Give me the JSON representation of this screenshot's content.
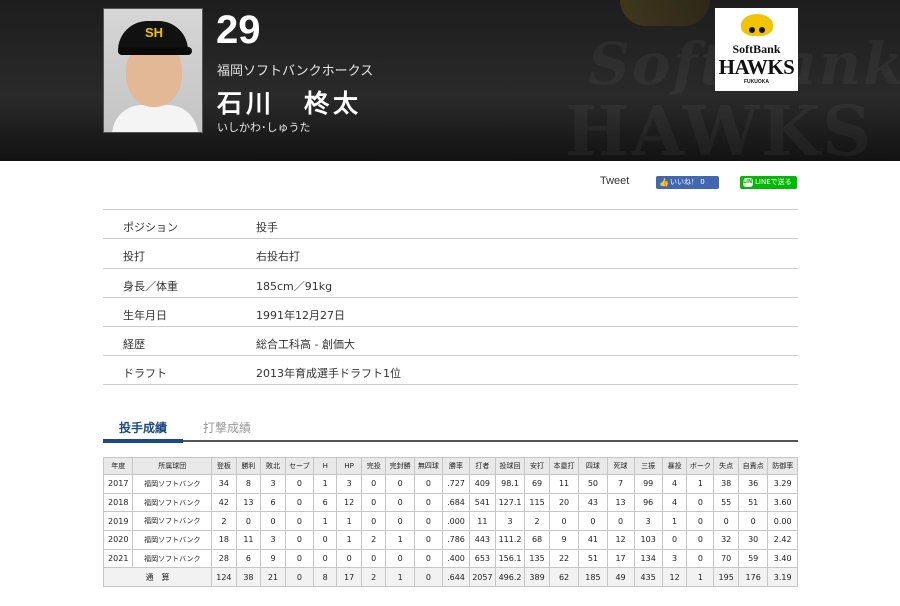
{
  "header": {
    "number": "29",
    "team": "福岡ソフトバンクホークス",
    "name": "石川　柊太",
    "kana": "いしかわ･しゅうた",
    "watermark_line1": "SoftBank",
    "watermark_line2": "HAWKS",
    "logo_line1": "SoftBank",
    "logo_line2": "HAWKS",
    "logo_line3": "FUKUOKA",
    "cap_logo": "SH"
  },
  "social": {
    "tweet": "Tweet",
    "facebook": "いいね！ 0",
    "line_badge": "LINE",
    "line": "LINEで送る",
    "facebook_color": "#4267b2",
    "line_color": "#00b900"
  },
  "profile": [
    {
      "label": "ポジション",
      "value": "投手"
    },
    {
      "label": "投打",
      "value": "右投右打"
    },
    {
      "label": "身長／体重",
      "value": "185cm／91kg"
    },
    {
      "label": "生年月日",
      "value": "1991年12月27日"
    },
    {
      "label": "経歴",
      "value": "総合工科高 - 創価大"
    },
    {
      "label": "ドラフト",
      "value": "2013年育成選手ドラフト1位"
    }
  ],
  "tabs": [
    {
      "label": "投手成績",
      "active": true
    },
    {
      "label": "打撃成績",
      "active": false
    }
  ],
  "stats": {
    "headers": [
      "年度",
      "所属球団",
      "登板",
      "勝利",
      "敗北",
      "セーブ",
      "H",
      "HP",
      "完投",
      "完封勝",
      "無四球",
      "勝率",
      "打者",
      "投球回",
      "安打",
      "本塁打",
      "四球",
      "死球",
      "三振",
      "暴投",
      "ボーク",
      "失点",
      "自責点",
      "防御率"
    ],
    "rows": [
      [
        "2017",
        "福岡ソフトバンク",
        "34",
        "8",
        "3",
        "0",
        "1",
        "3",
        "0",
        "0",
        "0",
        ".727",
        "409",
        "98.1",
        "69",
        "11",
        "50",
        "7",
        "99",
        "4",
        "1",
        "38",
        "36",
        "3.29"
      ],
      [
        "2018",
        "福岡ソフトバンク",
        "42",
        "13",
        "6",
        "0",
        "6",
        "12",
        "0",
        "0",
        "0",
        ".684",
        "541",
        "127.1",
        "115",
        "20",
        "43",
        "13",
        "96",
        "4",
        "0",
        "55",
        "51",
        "3.60"
      ],
      [
        "2019",
        "福岡ソフトバンク",
        "2",
        "0",
        "0",
        "0",
        "1",
        "1",
        "0",
        "0",
        "0",
        ".000",
        "11",
        "3",
        "2",
        "0",
        "0",
        "0",
        "3",
        "1",
        "0",
        "0",
        "0",
        "0.00"
      ],
      [
        "2020",
        "福岡ソフトバンク",
        "18",
        "11",
        "3",
        "0",
        "0",
        "1",
        "2",
        "1",
        "0",
        ".786",
        "443",
        "111.2",
        "68",
        "9",
        "41",
        "12",
        "103",
        "0",
        "0",
        "32",
        "30",
        "2.42"
      ],
      [
        "2021",
        "福岡ソフトバンク",
        "28",
        "6",
        "9",
        "0",
        "0",
        "0",
        "0",
        "0",
        "0",
        ".400",
        "653",
        "156.1",
        "135",
        "22",
        "51",
        "17",
        "134",
        "3",
        "0",
        "70",
        "59",
        "3.40"
      ]
    ],
    "total": [
      "通　算",
      "124",
      "38",
      "21",
      "0",
      "8",
      "17",
      "2",
      "1",
      "0",
      ".644",
      "2057",
      "496.2",
      "389",
      "62",
      "185",
      "49",
      "435",
      "12",
      "1",
      "195",
      "176",
      "3.19"
    ]
  }
}
